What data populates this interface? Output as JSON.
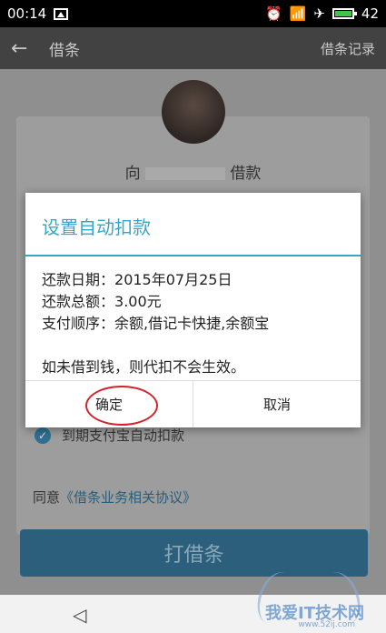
{
  "status_bar": {
    "time": "00:14",
    "battery_level": "42",
    "icons": [
      "image-icon",
      "alarm-icon",
      "wifi-icon",
      "airplane-icon",
      "battery-icon"
    ]
  },
  "app_bar": {
    "title": "借条",
    "record_link": "借条记录"
  },
  "page": {
    "lend_prefix": "向",
    "lend_suffix": "借款",
    "auto_repay_label": "到期支付宝自动扣款",
    "agree_prefix": "同意",
    "agree_link": "《借条业务相关协议》",
    "submit_label": "打借条"
  },
  "dialog": {
    "title": "设置自动扣款",
    "repay_date_label": "还款日期：",
    "repay_date": "2015年07月25日",
    "repay_amount_label": "还款总额：",
    "repay_amount": "3.00元",
    "pay_order_label": "支付顺序：",
    "pay_order": "余额,借记卡快捷,余额宝",
    "note": "如未借到钱，则代扣不会生效。",
    "confirm_label": "确定",
    "cancel_label": "取消"
  },
  "watermark": {
    "text": "我爱IT技术网",
    "url": "www.52ij.com"
  },
  "colors": {
    "accent": "#37a5c8",
    "annotation": "#d4212c",
    "button": "#2c5f7c"
  }
}
